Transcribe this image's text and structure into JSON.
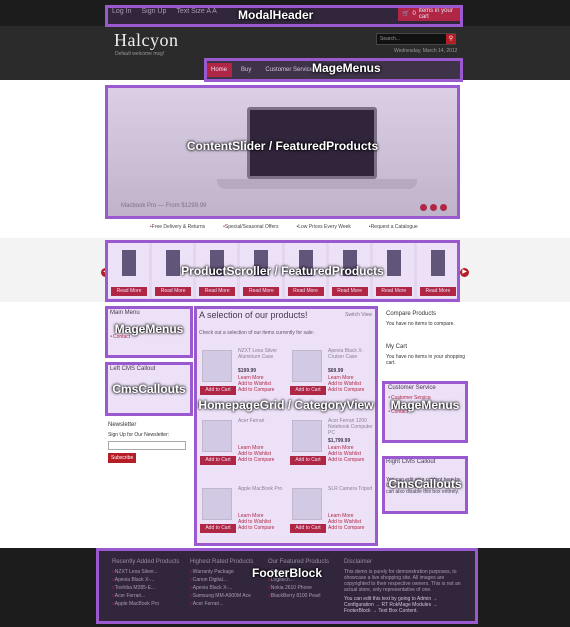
{
  "header": {
    "toplinks": [
      "Log In",
      "Sign Up",
      "Text Size A A"
    ],
    "cart_count": "0",
    "cart_text": "items in your cart",
    "logo": "Halcyon",
    "welcome": "Default welcome msg!",
    "search_placeholder": "Search...",
    "date": "Wednesday, March 14, 2012"
  },
  "nav": [
    "Home",
    "Buy",
    "Customer Service",
    "Contact"
  ],
  "slider": {
    "caption": "Macbook Pro — From $1299.99"
  },
  "features": [
    "Free Delivery & Returns",
    "Special/Seasonal Offers",
    "Low Prices Every Week",
    "Request a Catalogue"
  ],
  "scroller": {
    "read_more": "Read More"
  },
  "left": {
    "main_menu_title": "Main Menu",
    "main_menu_link": "Contact",
    "left_callout_title": "Left CMS Callout",
    "newsletter_title": "Newsletter",
    "newsletter_text": "Sign Up for Our Newsletter:",
    "subscribe": "Subscribe"
  },
  "center": {
    "title": "A selection of our products!",
    "switch_view": "Switch View",
    "intro": "Check out a selection of our items currently for sale:",
    "products": [
      {
        "name": "NZXT Lexa Silver Aluminum Case",
        "price": "$199.99"
      },
      {
        "name": "Apevia Black X-Cruiser Case",
        "price": "$69.99"
      },
      {
        "name": "Acer Ferrari 1200 Notebook Computer PC",
        "price": "$1,799.99"
      },
      {
        "name": "Acer Ferrari",
        "price": ""
      },
      {
        "name": "Apple MacBook Pro",
        "price": ""
      },
      {
        "name": "SLR Camera Tripod",
        "price": ""
      }
    ],
    "learn_more": "Learn More",
    "add_wishlist": "Add to Wishlist",
    "add_compare": "Add to Compare",
    "add_to_cart": "Add to Cart"
  },
  "right": {
    "compare_title": "Compare Products",
    "compare_text": "You have no items to compare.",
    "cart_title": "My Cart",
    "cart_text": "You have no items in your shopping cart.",
    "service_title": "Customer Service",
    "service_links": [
      "Customer Service",
      "Contact"
    ],
    "right_callout_title": "Right CMS Callout",
    "right_callout_text": "You can edit your content here by Callout → Right Callout Text. You can also disable this box entirely."
  },
  "footer": {
    "recent_title": "Recently Added Products",
    "recent": [
      "NZXT Lexa Silver...",
      "Apevia Black X-...",
      "Toshiba M285-E...",
      "Acer Ferrari...",
      "Apple MacBook Pro"
    ],
    "rated_title": "Highest Rated Products",
    "rated": [
      "Warranty Package",
      "Canon Digital...",
      "Apevia Black X-...",
      "Samsung MM-A900M Ace",
      "Acer Ferrari..."
    ],
    "featured_title": "Our Featured Products",
    "featured": [
      "Support Plan",
      "Logitech...",
      "Nokia 2610 Phone",
      "BlackBerry 8100 Pearl"
    ],
    "disclaimer_title": "Disclaimer",
    "disclaimer": "This demo is purely for demonstration purposes, to showcase a live shopping site. All images are copyrighted to their respective owners. This is not an actual store, only representative of one.",
    "edit_note": "You can edit this text by going to Admin → Configuration → RT RokMage Modules → FooterBlock → Text Box Content."
  },
  "annotations": {
    "modal_header": "ModalHeader",
    "mage_menus_top": "MageMenus",
    "content_slider": "ContentSlider / FeaturedProducts",
    "product_scroller": "ProductScroller / FeaturedProducts",
    "mage_menus_left": "MageMenus",
    "cms_callouts_left": "CmsCallouts",
    "homepage_grid": "HomepageGrid / CategoryView",
    "mage_menus_right": "MageMenus",
    "cms_callouts_right": "CmsCallouts",
    "footer_block": "FooterBlock"
  },
  "colors": {
    "accent": "#b51d27",
    "annotation": "#9b59d0",
    "dark": "#2b2b2b"
  }
}
